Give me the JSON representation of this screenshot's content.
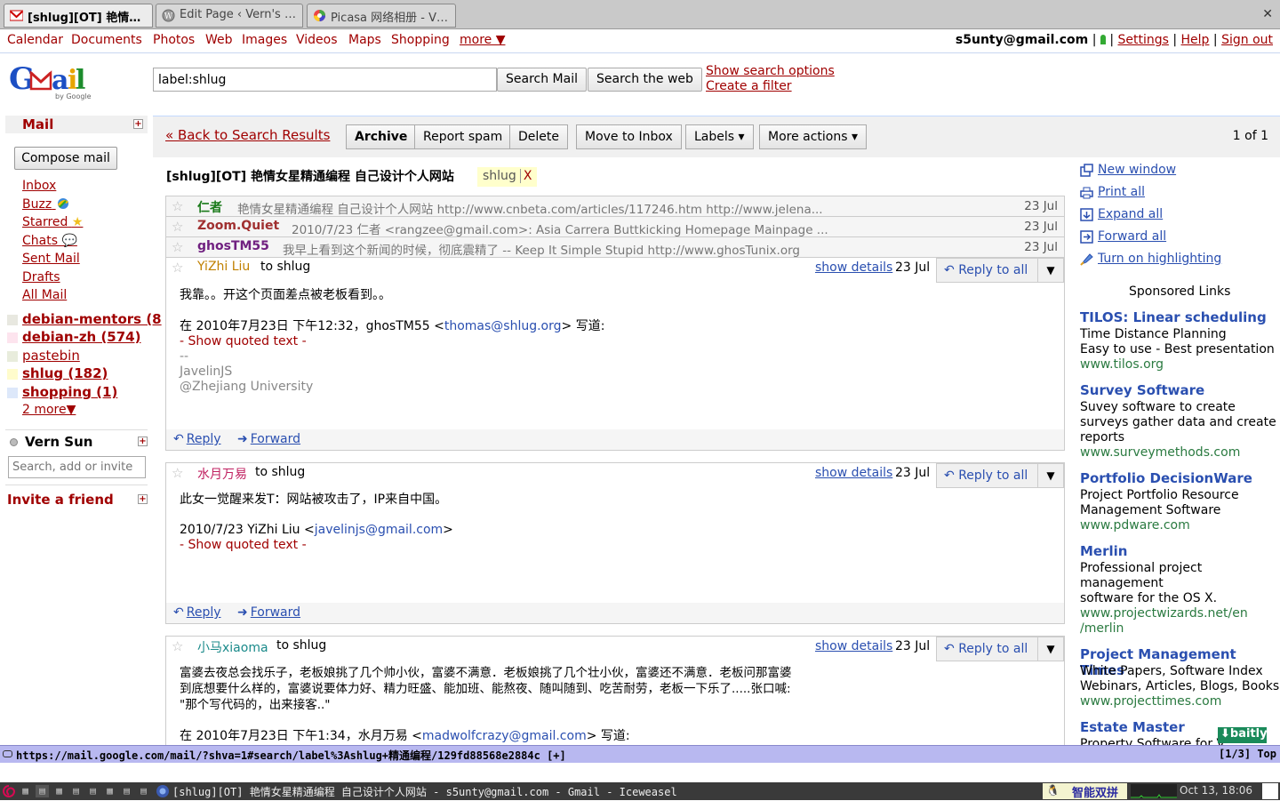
{
  "browser": {
    "tabs": [
      {
        "label": "[shlug][OT] 艳情…",
        "active": true,
        "icon": "gmail-icon"
      },
      {
        "label": "Edit Page ‹ Vern's …",
        "active": false,
        "icon": "wordpress-icon"
      },
      {
        "label": "Picasa 网络相册 - V…",
        "active": false,
        "icon": "picasa-icon"
      }
    ],
    "close_label": "✕"
  },
  "gbar": {
    "links": [
      "Calendar",
      "Documents",
      "Photos",
      "Web",
      "Images",
      "Videos",
      "Maps",
      "Shopping"
    ],
    "more_label": "more ▼",
    "account": "s5unty@gmail.com",
    "settings": "Settings",
    "help": "Help",
    "signout": "Sign out"
  },
  "header": {
    "logo_text": "Gmail",
    "logo_sub": "by Google",
    "search_value": "label:shlug",
    "search_mail": "Search Mail",
    "search_web": "Search the web",
    "show_options": "Show search options",
    "create_filter": "Create a filter"
  },
  "nav": {
    "mail": "Mail",
    "compose": "Compose mail",
    "items": [
      {
        "label": "Inbox"
      },
      {
        "label": "Buzz",
        "icon": "buzz-icon"
      },
      {
        "label": "Starred",
        "icon": "star-icon"
      },
      {
        "label": "Chats",
        "icon": "chat-bubble-icon"
      },
      {
        "label": "Sent Mail"
      },
      {
        "label": "Drafts"
      },
      {
        "label": "All Mail"
      }
    ],
    "labels": [
      {
        "label": "debian-mentors (8",
        "color": "#e8e8e0",
        "bold": true
      },
      {
        "label": "debian-zh (574)",
        "color": "#fde4ee",
        "bold": true
      },
      {
        "label": "pastebin",
        "color": "#e8ecdc",
        "bold": false
      },
      {
        "label": "shlug (182)",
        "color": "#fffccc",
        "bold": true
      },
      {
        "label": "shopping (1)",
        "color": "#dde8fa",
        "bold": true
      }
    ],
    "more_labels": "2 more▼",
    "chat_name": "Vern Sun",
    "chat_search_placeholder": "Search, add or invite",
    "invite": "Invite a friend"
  },
  "toolbar": {
    "back": "« Back to Search Results",
    "archive": "Archive",
    "report_spam": "Report spam",
    "delete": "Delete",
    "move_inbox": "Move to Inbox",
    "labels": "Labels ▾",
    "more_actions": "More actions ▾",
    "pager": "1 of 1"
  },
  "thread": {
    "subject": "[shlug][OT] 艳情女星精通编程 自己设计个人网站",
    "label_chip": "shlug",
    "label_remove": "X",
    "collapsed": [
      {
        "sender": "仁者",
        "color": "#1a7a1a",
        "snippet": "艳情女星精通编程 自己设计个人网站 http://www.cnbeta.com/articles/117246.htm http://www.jelena...",
        "date": "23 Jul"
      },
      {
        "sender": "Zoom.Quiet",
        "color": "#a03030",
        "snippet": "2010/7/23 仁者 <rangzee@gmail.com>: Asia Carrera Buttkicking Homepage Mainpage ...",
        "date": "23 Jul"
      },
      {
        "sender": "ghosTM55",
        "color": "#702080",
        "snippet": "我早上看到这个新闻的时候，彻底震精了 -- Keep It Simple Stupid http://www.ghosTunix.org",
        "date": "23 Jul"
      }
    ],
    "messages": [
      {
        "sender": "YiZhi Liu",
        "sender_color": "#c08000",
        "to": "to shlug",
        "show_details": "show details",
        "date": "23 Jul",
        "reply_all": "Reply to all",
        "body1": "我靠。。开这个页面差点被老板看到。。",
        "quote_prefix": "在 2010年7月23日 下午12:32，ghosTM55 <",
        "quote_email": "thomas@shlug.org",
        "quote_suffix": "> 写道:",
        "show_quoted": "- Show quoted text -",
        "sig1": "--",
        "sig2": "JavelinJS",
        "sig3": "@Zhejiang University",
        "reply": "Reply",
        "forward": "Forward"
      },
      {
        "sender": "水月万易",
        "sender_color": "#c02060",
        "to": "to shlug",
        "show_details": "show details",
        "date": "23 Jul",
        "reply_all": "Reply to all",
        "body1": "此女一觉醒来发T：网站被攻击了，IP来自中国。",
        "quote_prefix": "2010/7/23 YiZhi Liu <",
        "quote_email": "javelinjs@gmail.com",
        "quote_suffix": ">",
        "show_quoted": "- Show quoted text -",
        "reply": "Reply",
        "forward": "Forward"
      },
      {
        "sender": "小马xiaoma",
        "sender_color": "#1a8a8a",
        "to": "to shlug",
        "show_details": "show details",
        "date": "23 Jul",
        "reply_all": "Reply to all",
        "line1": "富婆去夜总会找乐子，老板娘挑了几个帅小伙，富婆不满意．老板娘挑了几个壮小伙，富婆还不满意．老板问那富婆",
        "line2": "到底想要什么样的，富婆说要体力好、精力旺盛、能加班、能熬夜、随叫随到、吃苦耐劳，老板一下乐了.....张口喊:",
        "line3": "\"那个写代码的，出来接客..\"",
        "quote_prefix": "在 2010年7月23日 下午1:34，水月万易 <",
        "quote_email": "madwolfcrazy@gmail.com",
        "quote_suffix": "> 写道:"
      }
    ]
  },
  "sidebar": {
    "actions": [
      {
        "label": "New window",
        "icon": "new-window-icon"
      },
      {
        "label": "Print all",
        "icon": "print-icon"
      },
      {
        "label": "Expand all",
        "icon": "expand-icon"
      },
      {
        "label": "Forward all",
        "icon": "forward-icon"
      },
      {
        "label": "Turn on highlighting",
        "icon": "highlighter-icon"
      }
    ],
    "sponsored": "Sponsored Links",
    "ads": [
      {
        "title": "TILOS: Linear scheduling",
        "lines": [
          "Time Distance Planning",
          "Easy to use - Best presentation"
        ],
        "url": "www.tilos.org"
      },
      {
        "title": "Survey Software",
        "lines": [
          "Suvey software to create",
          "surveys gather data and create",
          "reports"
        ],
        "url": "www.surveymethods.com"
      },
      {
        "title": "Portfolio DecisionWare",
        "lines": [
          "Project Portfolio Resource",
          "Management Software"
        ],
        "url": "www.pdware.com"
      },
      {
        "title": "Merlin",
        "lines": [
          "Professional project",
          "management",
          "software for the OS X."
        ],
        "url": "www.projectwizards.net/en\n/merlin"
      },
      {
        "title": "Project Management Times",
        "lines": [
          "White Papers, Software Index",
          "Webinars, Articles, Blogs, Books"
        ],
        "url": "www.projecttimes.com"
      },
      {
        "title": "Estate Master",
        "lines": [
          "Property Software for V"
        ],
        "url": ""
      }
    ],
    "baitly": "⬇baitly"
  },
  "statusbar": {
    "url": "https://mail.google.com/mail/?shva=1#search/label%3Ashlug+精通编程/129fd88568e2884c [+]",
    "page": "[1/3] Top"
  },
  "taskbar": {
    "title": "[shlug][OT] 艳情女星精通编程 自己设计个人网站 - s5unty@gmail.com - Gmail - Iceweasel",
    "ime": "智能双拼",
    "clock": "Oct 13, 18:06"
  },
  "colors": {
    "gmail_red": "#a00000",
    "link_blue": "#2a4fb0",
    "ad_green": "#2a7a40"
  }
}
